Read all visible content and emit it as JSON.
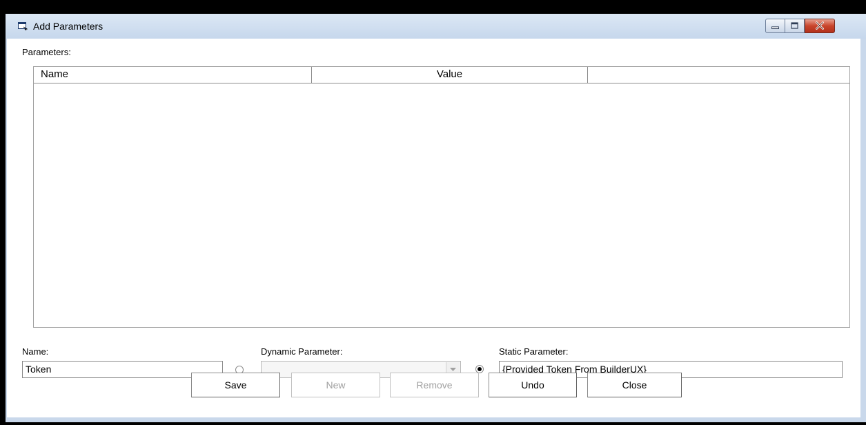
{
  "window": {
    "title": "Add Parameters"
  },
  "parameters": {
    "label": "Parameters:",
    "columns": [
      "Name",
      "Value",
      ""
    ],
    "rows": []
  },
  "form": {
    "name_label": "Name:",
    "name_value": "Token",
    "dynamic_label": "Dynamic Parameter:",
    "dynamic_value": "",
    "static_label": "Static Parameter:",
    "static_value": "{Provided Token From BuilderUX}",
    "selected_mode": "static"
  },
  "buttons": {
    "save": "Save",
    "new": "New",
    "remove": "Remove",
    "undo": "Undo",
    "close": "Close"
  }
}
